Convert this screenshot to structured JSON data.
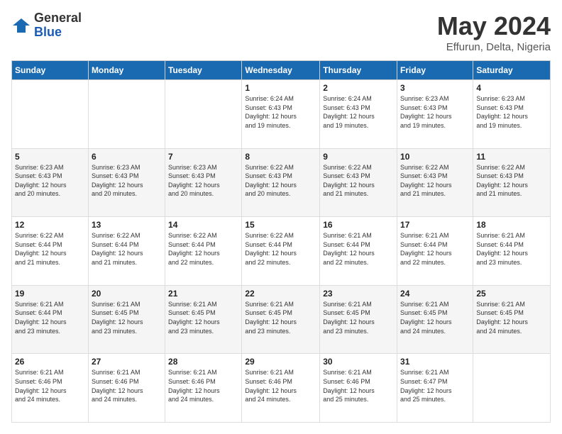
{
  "logo": {
    "general": "General",
    "blue": "Blue"
  },
  "title": "May 2024",
  "subtitle": "Effurun, Delta, Nigeria",
  "headers": [
    "Sunday",
    "Monday",
    "Tuesday",
    "Wednesday",
    "Thursday",
    "Friday",
    "Saturday"
  ],
  "weeks": [
    [
      {
        "day": "",
        "info": ""
      },
      {
        "day": "",
        "info": ""
      },
      {
        "day": "",
        "info": ""
      },
      {
        "day": "1",
        "info": "Sunrise: 6:24 AM\nSunset: 6:43 PM\nDaylight: 12 hours\nand 19 minutes."
      },
      {
        "day": "2",
        "info": "Sunrise: 6:24 AM\nSunset: 6:43 PM\nDaylight: 12 hours\nand 19 minutes."
      },
      {
        "day": "3",
        "info": "Sunrise: 6:23 AM\nSunset: 6:43 PM\nDaylight: 12 hours\nand 19 minutes."
      },
      {
        "day": "4",
        "info": "Sunrise: 6:23 AM\nSunset: 6:43 PM\nDaylight: 12 hours\nand 19 minutes."
      }
    ],
    [
      {
        "day": "5",
        "info": "Sunrise: 6:23 AM\nSunset: 6:43 PM\nDaylight: 12 hours\nand 20 minutes."
      },
      {
        "day": "6",
        "info": "Sunrise: 6:23 AM\nSunset: 6:43 PM\nDaylight: 12 hours\nand 20 minutes."
      },
      {
        "day": "7",
        "info": "Sunrise: 6:23 AM\nSunset: 6:43 PM\nDaylight: 12 hours\nand 20 minutes."
      },
      {
        "day": "8",
        "info": "Sunrise: 6:22 AM\nSunset: 6:43 PM\nDaylight: 12 hours\nand 20 minutes."
      },
      {
        "day": "9",
        "info": "Sunrise: 6:22 AM\nSunset: 6:43 PM\nDaylight: 12 hours\nand 21 minutes."
      },
      {
        "day": "10",
        "info": "Sunrise: 6:22 AM\nSunset: 6:43 PM\nDaylight: 12 hours\nand 21 minutes."
      },
      {
        "day": "11",
        "info": "Sunrise: 6:22 AM\nSunset: 6:43 PM\nDaylight: 12 hours\nand 21 minutes."
      }
    ],
    [
      {
        "day": "12",
        "info": "Sunrise: 6:22 AM\nSunset: 6:44 PM\nDaylight: 12 hours\nand 21 minutes."
      },
      {
        "day": "13",
        "info": "Sunrise: 6:22 AM\nSunset: 6:44 PM\nDaylight: 12 hours\nand 21 minutes."
      },
      {
        "day": "14",
        "info": "Sunrise: 6:22 AM\nSunset: 6:44 PM\nDaylight: 12 hours\nand 22 minutes."
      },
      {
        "day": "15",
        "info": "Sunrise: 6:22 AM\nSunset: 6:44 PM\nDaylight: 12 hours\nand 22 minutes."
      },
      {
        "day": "16",
        "info": "Sunrise: 6:21 AM\nSunset: 6:44 PM\nDaylight: 12 hours\nand 22 minutes."
      },
      {
        "day": "17",
        "info": "Sunrise: 6:21 AM\nSunset: 6:44 PM\nDaylight: 12 hours\nand 22 minutes."
      },
      {
        "day": "18",
        "info": "Sunrise: 6:21 AM\nSunset: 6:44 PM\nDaylight: 12 hours\nand 23 minutes."
      }
    ],
    [
      {
        "day": "19",
        "info": "Sunrise: 6:21 AM\nSunset: 6:44 PM\nDaylight: 12 hours\nand 23 minutes."
      },
      {
        "day": "20",
        "info": "Sunrise: 6:21 AM\nSunset: 6:45 PM\nDaylight: 12 hours\nand 23 minutes."
      },
      {
        "day": "21",
        "info": "Sunrise: 6:21 AM\nSunset: 6:45 PM\nDaylight: 12 hours\nand 23 minutes."
      },
      {
        "day": "22",
        "info": "Sunrise: 6:21 AM\nSunset: 6:45 PM\nDaylight: 12 hours\nand 23 minutes."
      },
      {
        "day": "23",
        "info": "Sunrise: 6:21 AM\nSunset: 6:45 PM\nDaylight: 12 hours\nand 23 minutes."
      },
      {
        "day": "24",
        "info": "Sunrise: 6:21 AM\nSunset: 6:45 PM\nDaylight: 12 hours\nand 24 minutes."
      },
      {
        "day": "25",
        "info": "Sunrise: 6:21 AM\nSunset: 6:45 PM\nDaylight: 12 hours\nand 24 minutes."
      }
    ],
    [
      {
        "day": "26",
        "info": "Sunrise: 6:21 AM\nSunset: 6:46 PM\nDaylight: 12 hours\nand 24 minutes."
      },
      {
        "day": "27",
        "info": "Sunrise: 6:21 AM\nSunset: 6:46 PM\nDaylight: 12 hours\nand 24 minutes."
      },
      {
        "day": "28",
        "info": "Sunrise: 6:21 AM\nSunset: 6:46 PM\nDaylight: 12 hours\nand 24 minutes."
      },
      {
        "day": "29",
        "info": "Sunrise: 6:21 AM\nSunset: 6:46 PM\nDaylight: 12 hours\nand 24 minutes."
      },
      {
        "day": "30",
        "info": "Sunrise: 6:21 AM\nSunset: 6:46 PM\nDaylight: 12 hours\nand 25 minutes."
      },
      {
        "day": "31",
        "info": "Sunrise: 6:21 AM\nSunset: 6:47 PM\nDaylight: 12 hours\nand 25 minutes."
      },
      {
        "day": "",
        "info": ""
      }
    ]
  ]
}
